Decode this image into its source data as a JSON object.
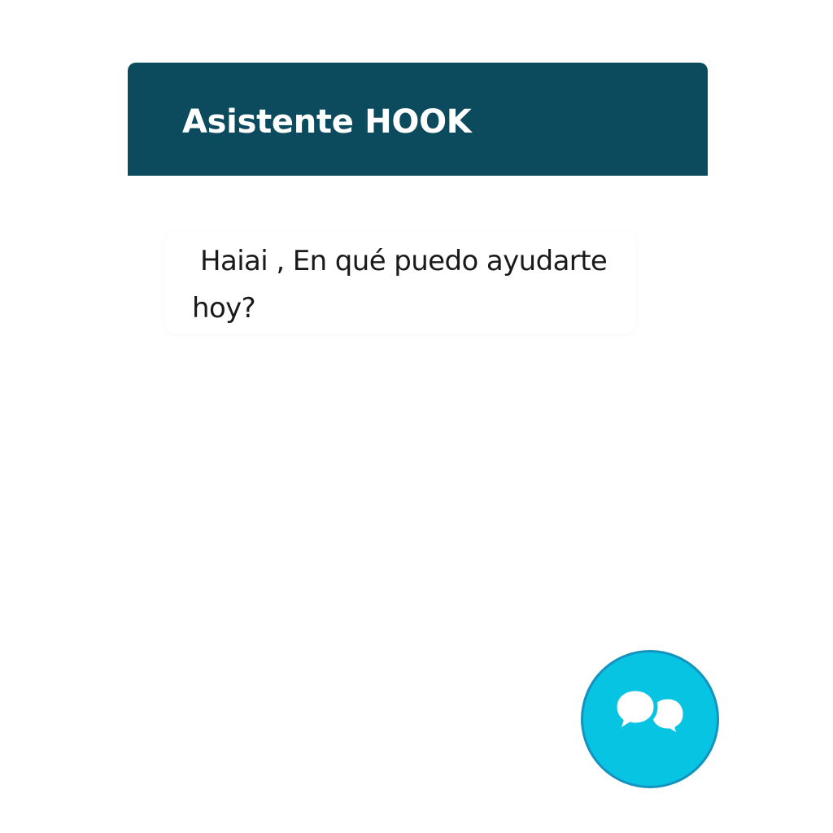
{
  "header": {
    "title": "Asistente HOOK"
  },
  "messages": [
    {
      "text": "Haiai , En qué puedo ayudarte hoy?"
    }
  ],
  "launcher": {
    "icon": "chat-bubbles-icon"
  },
  "colors": {
    "header_background": "#0c4a5e",
    "header_text": "#ffffff",
    "message_text": "#1a1a1a",
    "launcher_fill": "#06c4e2",
    "launcher_border": "#1493bf"
  }
}
